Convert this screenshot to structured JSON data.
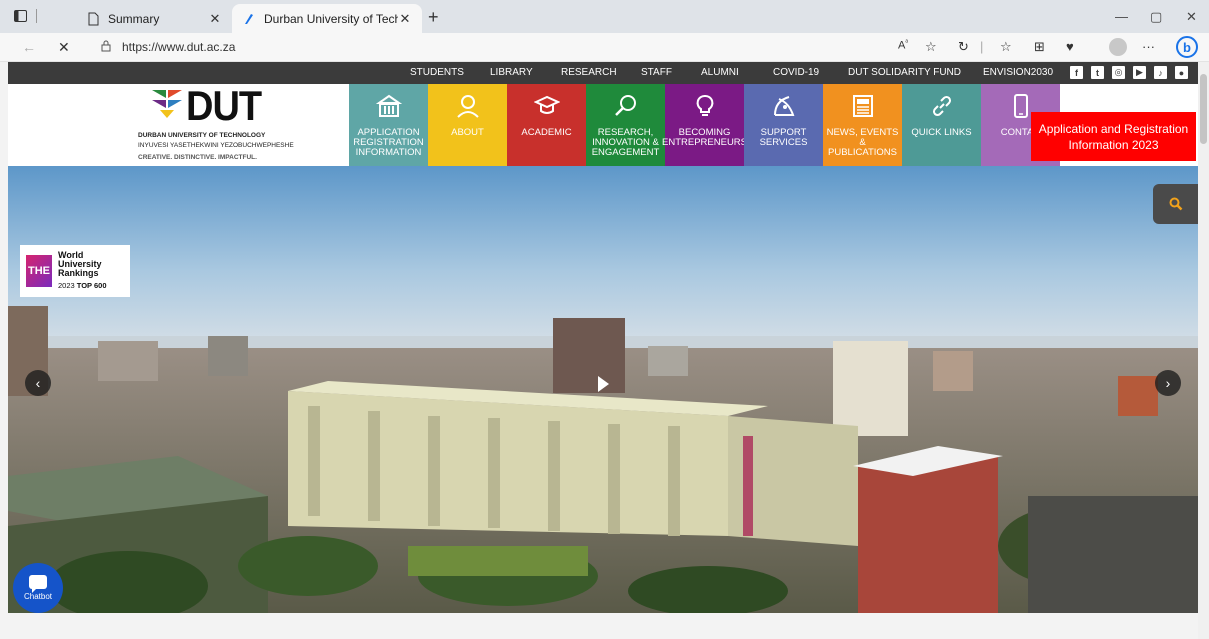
{
  "browser": {
    "tabs": [
      {
        "title": "Summary",
        "active": false
      },
      {
        "title": "Durban University of Technology",
        "active": true
      }
    ],
    "url": "https://www.dut.ac.za"
  },
  "topnav": {
    "items": [
      "STUDENTS",
      "LIBRARY",
      "RESEARCH",
      "STAFF",
      "ALUMNI",
      "COVID-19",
      "DUT SOLIDARITY FUND",
      "ENVISION2030"
    ],
    "social": [
      "facebook-icon",
      "twitter-icon",
      "instagram-icon",
      "youtube-icon",
      "tiktok-icon",
      "flickr-icon"
    ]
  },
  "logo": {
    "word": "DUT",
    "line1": "DURBAN UNIVERSITY OF TECHNOLOGY",
    "line2": "INYUVESI YASETHEKWINI YEZOBUCHWEPHESHE",
    "tagline": "CREATIVE. DISTINCTIVE. IMPACTFUL."
  },
  "menu": [
    {
      "label": "APPLICATION REGISTRATION INFORMATION",
      "color": "#5fa6a6",
      "icon": "building-icon"
    },
    {
      "label": "ABOUT",
      "color": "#f2c21b",
      "icon": "person-icon"
    },
    {
      "label": "ACADEMIC",
      "color": "#c8302c",
      "icon": "graduation-cap-icon"
    },
    {
      "label": "RESEARCH, INNOVATION & ENGAGEMENT",
      "color": "#1f8a3b",
      "icon": "magnifier-icon"
    },
    {
      "label": "BECOMING ENTREPRENEURS",
      "color": "#7b1a85",
      "icon": "lightbulb-icon"
    },
    {
      "label": "SUPPORT SERVICES",
      "color": "#5a6ab0",
      "icon": "satellite-icon"
    },
    {
      "label": "NEWS, EVENTS & PUBLICATIONS",
      "color": "#f1911f",
      "icon": "newspaper-icon"
    },
    {
      "label": "QUICK LINKS",
      "color": "#4e9a96",
      "icon": "link-icon"
    },
    {
      "label": "CONTAC",
      "color": "#a46ab8",
      "icon": "phone-icon"
    }
  ],
  "registration_button": "Application and Registration Information 2023",
  "badge": {
    "logo": "THE",
    "line1": "World",
    "line2": "University",
    "line3": "Rankings",
    "year": "2023",
    "rank": "TOP 600"
  },
  "chatbot_label": "Chatbot"
}
